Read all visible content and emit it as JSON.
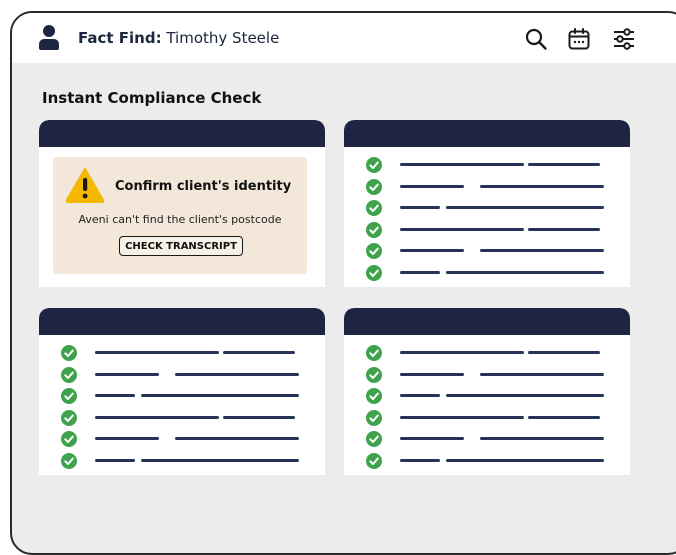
{
  "header": {
    "title_prefix": "Fact Find:",
    "client_name": "Timothy Steele",
    "icons": [
      "user-icon",
      "search-icon",
      "calendar-icon",
      "filter-sliders-icon"
    ]
  },
  "section_title": "Instant Compliance Check",
  "alert_card": {
    "title": "Confirm client's identity",
    "message": "Aveni can't find the client's postcode",
    "button_label": "CHECK TRANSCRIPT",
    "icon": "warning-triangle-icon"
  },
  "colors": {
    "card_header": "#1d2543",
    "check": "#3fa34d",
    "alert_bg": "#f2e7d8",
    "warning": "#f5b800"
  }
}
